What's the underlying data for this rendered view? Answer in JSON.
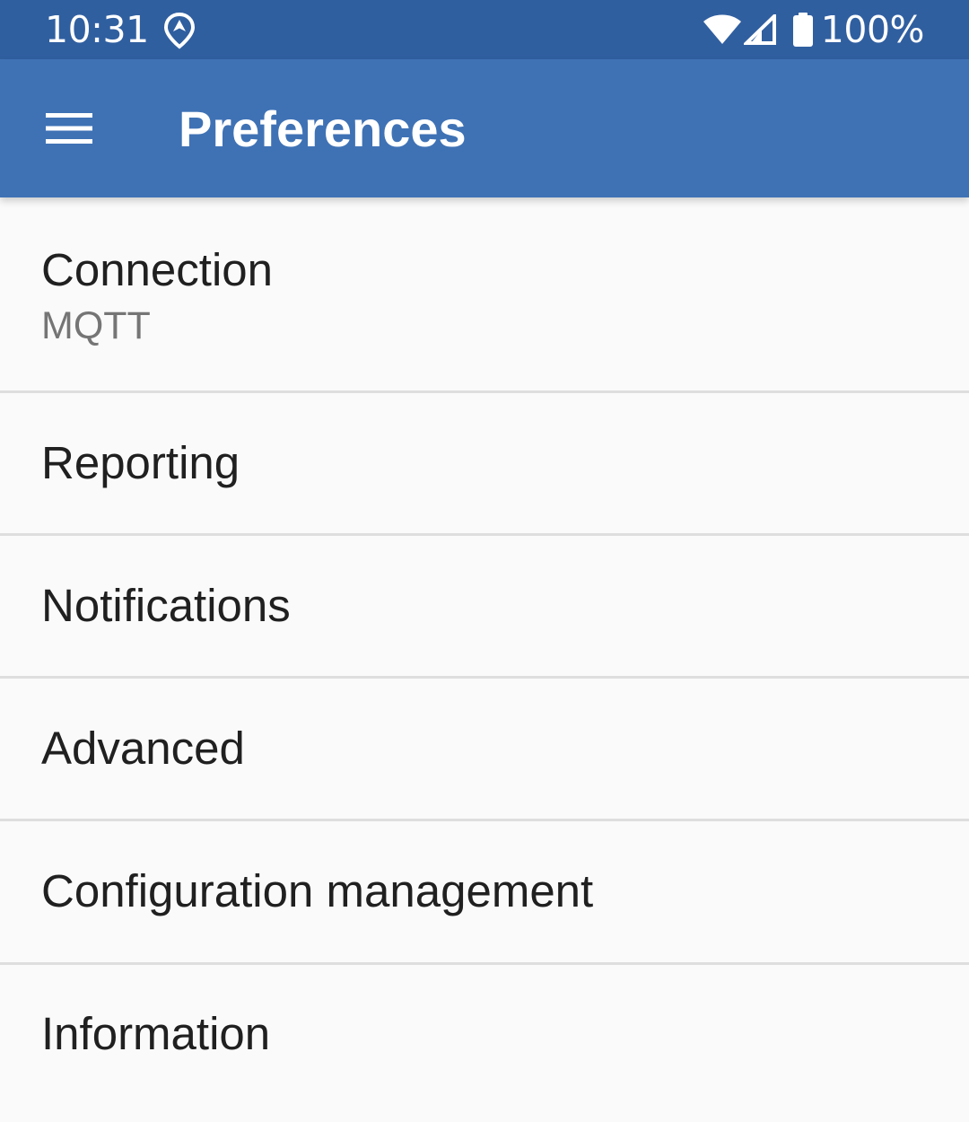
{
  "status_bar": {
    "time": "10:31",
    "battery": "100%",
    "icons": [
      "location-icon",
      "wifi-icon",
      "cell-signal-icon",
      "battery-icon"
    ]
  },
  "app_bar": {
    "title": "Preferences",
    "menu_icon": "hamburger-menu-icon",
    "background_color": "#3f72b5",
    "status_bar_color": "#305fa0"
  },
  "preferences": [
    {
      "title": "Connection",
      "summary": "MQTT"
    },
    {
      "title": "Reporting"
    },
    {
      "title": "Notifications"
    },
    {
      "title": "Advanced"
    },
    {
      "title": "Configuration management"
    },
    {
      "title": "Information"
    }
  ]
}
